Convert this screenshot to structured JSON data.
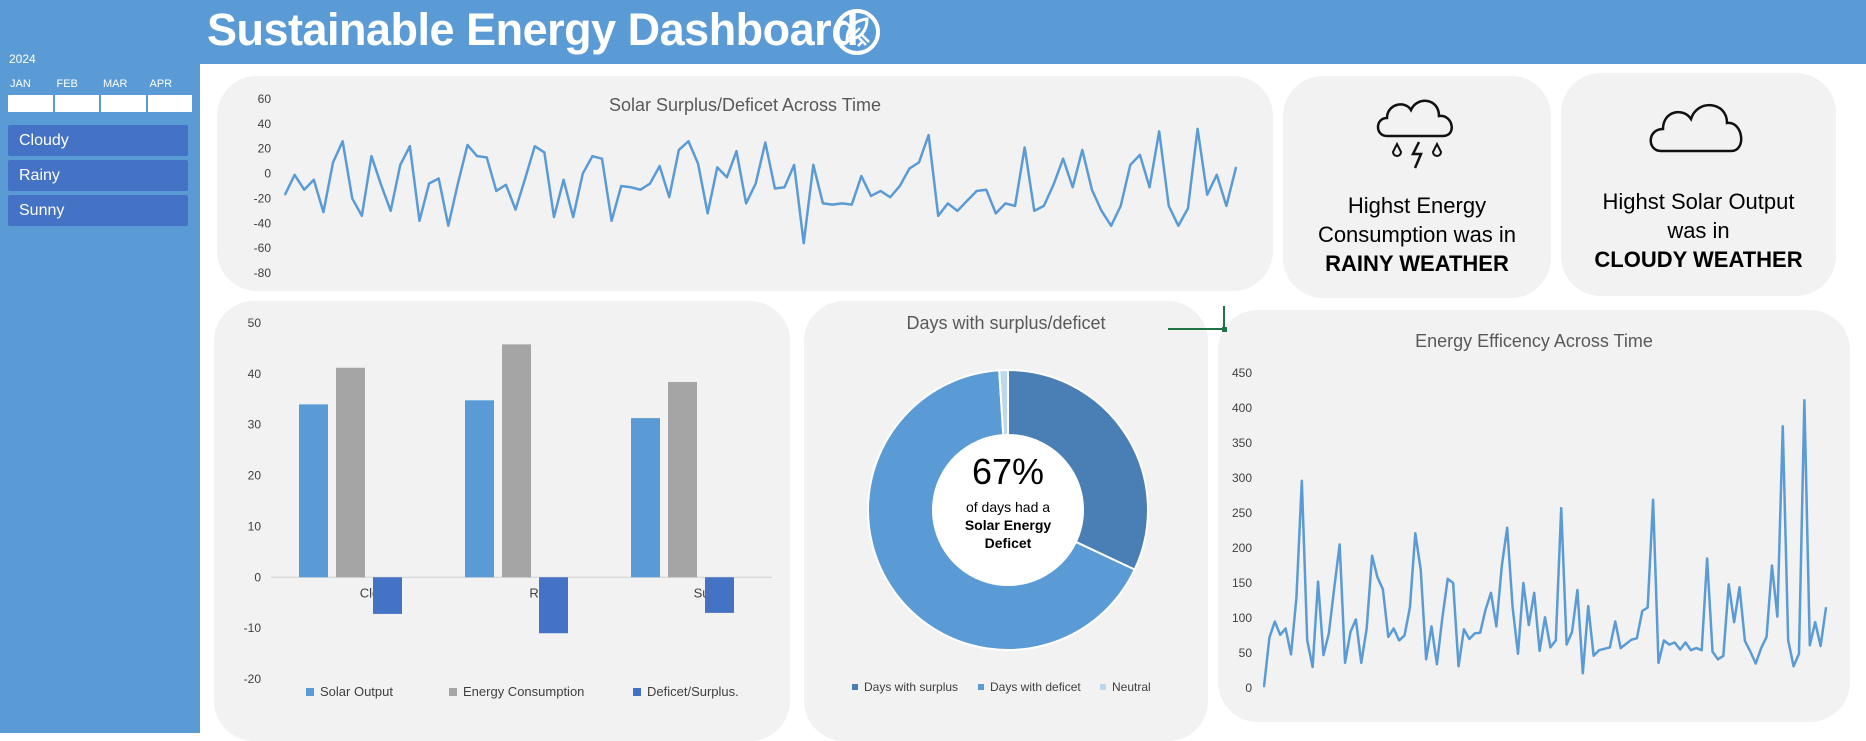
{
  "header": {
    "title": "Sustainable Energy Dashboard",
    "logo_icon": "leaf-plug-icon"
  },
  "sidebar": {
    "year": "2024",
    "months": [
      "JAN",
      "FEB",
      "MAR",
      "APR"
    ],
    "weather_slicers": [
      "Cloudy",
      "Rainy",
      "Sunny"
    ]
  },
  "colors": {
    "header_bg": "#5b9bd5",
    "card_bg": "#f2f2f2",
    "line": "#5b9bd5",
    "slicer": "#4472c4"
  },
  "cards": {
    "consumption": {
      "icon": "rain-cloud-lightning-icon",
      "line1": "Highst Energy",
      "line2": "Consumption was in",
      "value": "RAINY WEATHER"
    },
    "solar_output": {
      "icon": "cloud-icon",
      "line1": "Highst Solar Output",
      "line2": "was in",
      "value": "CLOUDY WEATHER"
    }
  },
  "donut_center": {
    "percent": "67%",
    "line1": "of days had a",
    "line2": "Solar Energy",
    "line3": "Deficet"
  },
  "chart_data": [
    {
      "type": "line",
      "title": "Solar Surplus/Deficet Across Time",
      "ylim": [
        -80,
        60
      ],
      "yticks": [
        60,
        40,
        20,
        0,
        -20,
        -40,
        -60,
        -80
      ],
      "values": [
        -17,
        -1,
        -13,
        -5,
        -31,
        9,
        26,
        -20,
        -34,
        14,
        -9,
        -30,
        7,
        22,
        -38,
        -8,
        -4,
        -42,
        -8,
        23,
        14,
        13,
        -14,
        -9,
        -29,
        -4,
        22,
        17,
        -35,
        -5,
        -35,
        0,
        14,
        12,
        -38,
        -10,
        -11,
        -13,
        -8,
        6,
        -19,
        19,
        26,
        8,
        -32,
        5,
        -3,
        18,
        -24,
        -8,
        25,
        -12,
        -11,
        7,
        -56,
        7,
        -24,
        -25,
        -24,
        -25,
        -2,
        -18,
        -14,
        -19,
        -10,
        4,
        9,
        31,
        -34,
        -24,
        -30,
        -22,
        -14,
        -13,
        -32,
        -24,
        -26,
        21,
        -30,
        -26,
        -9,
        12,
        -11,
        19,
        -13,
        -30,
        -42,
        -26,
        7,
        15,
        -11,
        34,
        -26,
        -42,
        -28,
        36,
        -17,
        -1,
        -26,
        5
      ]
    },
    {
      "type": "bar",
      "categories": [
        "Cloudy",
        "Rainy",
        "Sunny"
      ],
      "ylim": [
        -20,
        50
      ],
      "yticks": [
        50,
        40,
        30,
        20,
        10,
        0,
        -10,
        -20
      ],
      "series": [
        {
          "name": "Solar Output",
          "color": "#5b9bd5",
          "values": [
            34,
            34.8,
            31.3
          ]
        },
        {
          "name": "Energy Consumption",
          "color": "#a5a5a5",
          "values": [
            41.2,
            45.8,
            38.4
          ]
        },
        {
          "name": "Deficet/Surplus.",
          "color": "#4472c4",
          "values": [
            -7.2,
            -11,
            -7
          ]
        }
      ]
    },
    {
      "type": "pie",
      "title": "Days with surplus/deficet",
      "labels": [
        "Days with surplus",
        "Days with deficet",
        "Neutral"
      ],
      "values": [
        32,
        67,
        1
      ],
      "colors": [
        "#4a7fb5",
        "#5b9bd5",
        "#bdd7ee"
      ]
    },
    {
      "type": "line",
      "title": "Energy Efficency Across Time",
      "ylim": [
        0,
        450
      ],
      "yticks": [
        450,
        400,
        350,
        300,
        250,
        200,
        150,
        100,
        50,
        0
      ],
      "values": [
        2,
        72,
        95,
        76,
        85,
        48,
        129,
        296,
        68,
        30,
        152,
        47,
        78,
        143,
        205,
        36,
        80,
        98,
        36,
        85,
        189,
        158,
        141,
        73,
        85,
        68,
        75,
        115,
        221,
        169,
        41,
        88,
        34,
        100,
        156,
        150,
        31,
        84,
        70,
        78,
        79,
        112,
        136,
        88,
        174,
        229,
        116,
        49,
        150,
        90,
        136,
        53,
        101,
        58,
        68,
        257,
        62,
        80,
        140,
        21,
        117,
        46,
        54,
        56,
        58,
        95,
        57,
        63,
        69,
        71,
        110,
        115,
        269,
        36,
        68,
        62,
        65,
        55,
        65,
        54,
        57,
        54,
        185,
        52,
        41,
        46,
        148,
        94,
        144,
        67,
        52,
        35,
        57,
        73,
        175,
        102,
        374,
        68,
        31,
        49,
        411,
        61,
        94,
        60,
        115
      ]
    }
  ]
}
